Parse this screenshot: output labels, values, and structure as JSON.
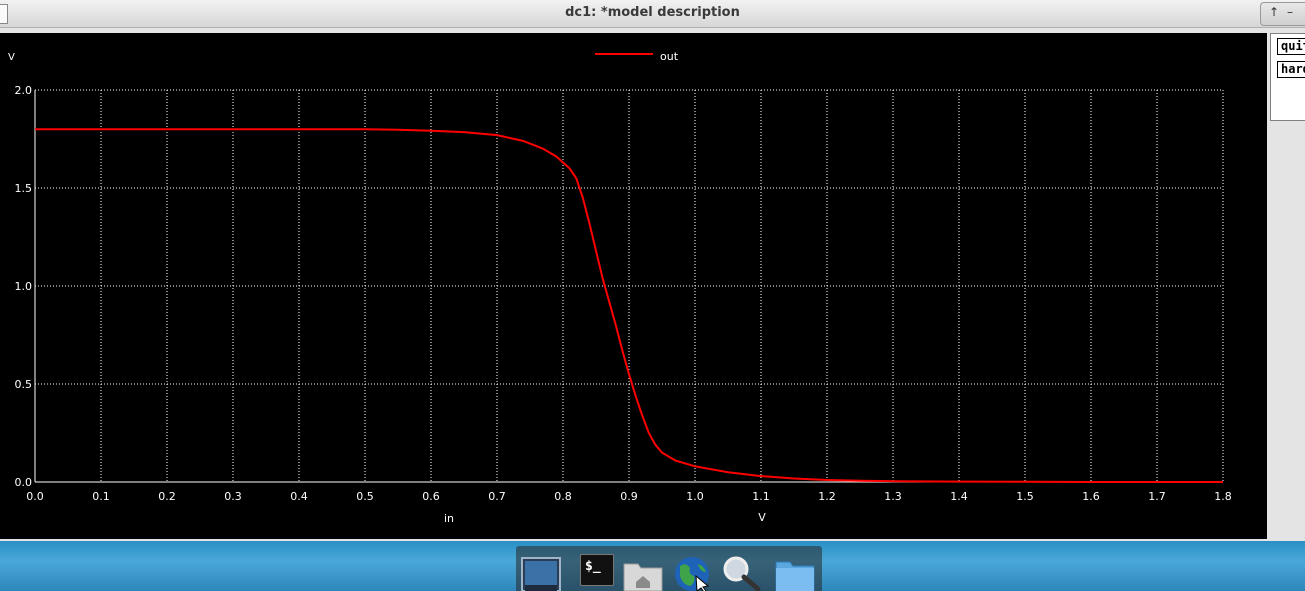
{
  "window": {
    "title": "dc1: *model description"
  },
  "side_panel": {
    "buttons": [
      "quit",
      "hardcopy"
    ]
  },
  "plot": {
    "background": "#000000",
    "grid_color": "#ffffff",
    "trace_color": "#ff0000"
  },
  "chart_data": {
    "type": "line",
    "title": "",
    "xlabel": "in",
    "xunit": "V",
    "ylabel": "V",
    "xlim": [
      0.0,
      1.8
    ],
    "ylim": [
      0.0,
      2.0
    ],
    "xticks": [
      "0.0",
      "0.1",
      "0.2",
      "0.3",
      "0.4",
      "0.5",
      "0.6",
      "0.7",
      "0.8",
      "0.9",
      "1.0",
      "1.1",
      "1.2",
      "1.3",
      "1.4",
      "1.5",
      "1.6",
      "1.7",
      "1.8"
    ],
    "yticks": [
      "0.0",
      "0.5",
      "1.0",
      "1.5",
      "2.0"
    ],
    "grid": true,
    "legend_position": "top-center",
    "series": [
      {
        "name": "out",
        "color": "#ff0000",
        "x": [
          0.0,
          0.1,
          0.2,
          0.3,
          0.4,
          0.5,
          0.55,
          0.6,
          0.65,
          0.7,
          0.74,
          0.77,
          0.79,
          0.81,
          0.82,
          0.83,
          0.84,
          0.85,
          0.86,
          0.87,
          0.88,
          0.89,
          0.9,
          0.91,
          0.92,
          0.93,
          0.94,
          0.95,
          0.97,
          1.0,
          1.05,
          1.1,
          1.15,
          1.2,
          1.25,
          1.3,
          1.4,
          1.5,
          1.6,
          1.7,
          1.8
        ],
        "y": [
          1.8,
          1.8,
          1.8,
          1.8,
          1.8,
          1.8,
          1.797,
          1.792,
          1.785,
          1.77,
          1.74,
          1.7,
          1.66,
          1.6,
          1.55,
          1.45,
          1.32,
          1.18,
          1.04,
          0.92,
          0.8,
          0.67,
          0.55,
          0.44,
          0.34,
          0.25,
          0.19,
          0.15,
          0.11,
          0.08,
          0.05,
          0.03,
          0.018,
          0.01,
          0.006,
          0.004,
          0.002,
          0.001,
          0.0,
          0.0,
          0.0
        ]
      }
    ]
  },
  "dock": {
    "icons": [
      "desktop-icon",
      "terminal-icon",
      "home-folder-icon",
      "browser-icon",
      "search-icon",
      "folder-icon"
    ],
    "terminal_glyph": "$_"
  }
}
